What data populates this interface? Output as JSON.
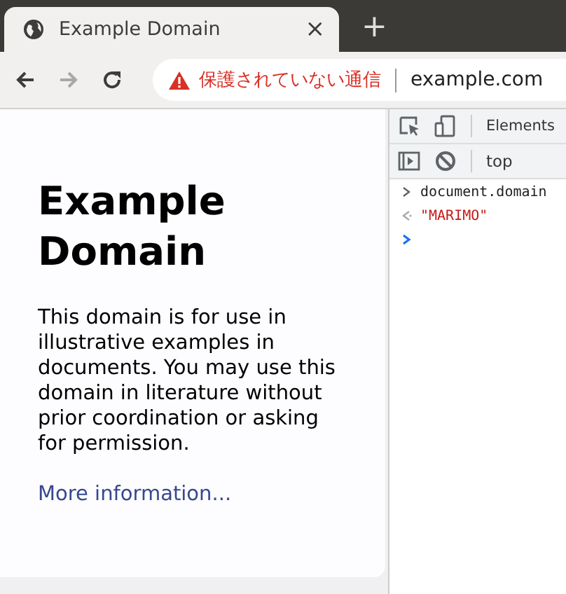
{
  "tab": {
    "title": "Example Domain",
    "close": "×"
  },
  "new_tab": "+",
  "address_bar": {
    "security": "保護されていない通信",
    "url": "example.com"
  },
  "page": {
    "heading": "Example Domain",
    "paragraph": "This domain is for use in illustrative examples in documents. You may use this domain in literature without prior coordination or asking for permission.",
    "link": "More information..."
  },
  "devtools": {
    "tabs": [
      {
        "label": "Elements",
        "selected": false
      }
    ],
    "context": "top",
    "console": [
      {
        "kind": "input",
        "text": "document.domain"
      },
      {
        "kind": "output",
        "text": "\"MARIMO\""
      },
      {
        "kind": "prompt"
      }
    ]
  }
}
